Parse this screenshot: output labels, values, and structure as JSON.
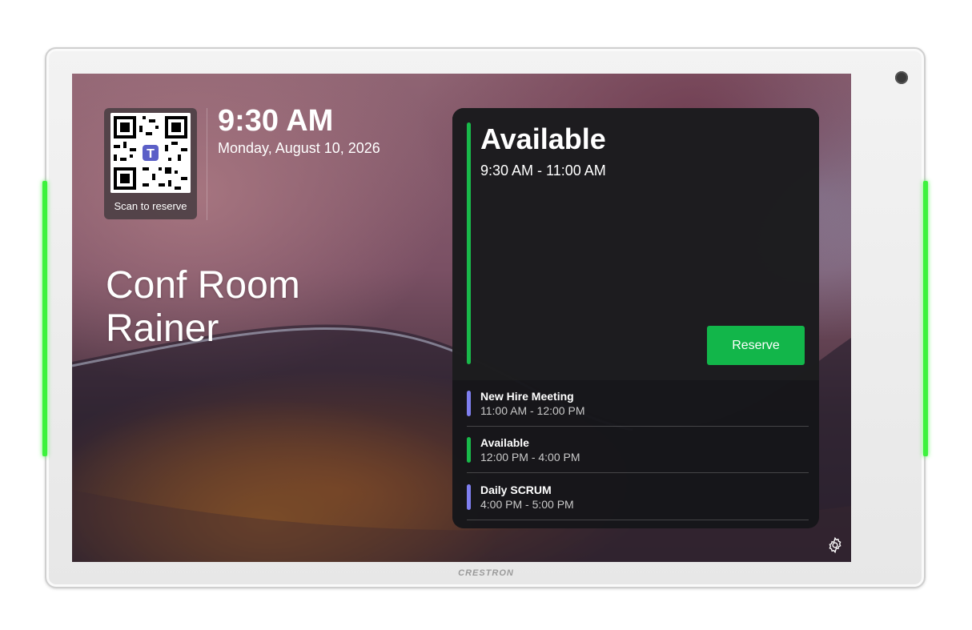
{
  "colors": {
    "available_green": "#19b94a",
    "reserve_button": "#12b64a",
    "led_green": "#3df23d",
    "meeting_purple": "#7f7ff0"
  },
  "device": {
    "brand": "CRESTRON"
  },
  "qr": {
    "caption": "Scan to reserve",
    "icon": "teams-qr-icon"
  },
  "clock": {
    "time": "9:30 AM",
    "date": "Monday, August 10, 2026"
  },
  "room": {
    "line1": "Conf Room",
    "line2": "Rainer"
  },
  "status": {
    "title": "Available",
    "time_range": "9:30 AM - 11:00 AM",
    "reserve_label": "Reserve"
  },
  "meetings": [
    {
      "title": "New Hire Meeting",
      "time": "11:00 AM - 12:00 PM",
      "color": "#7f7ff0"
    },
    {
      "title": "Available",
      "time": "12:00 PM - 4:00 PM",
      "color": "#19b94a"
    },
    {
      "title": "Daily SCRUM",
      "time": "4:00 PM - 5:00 PM",
      "color": "#7f7ff0"
    }
  ],
  "settings": {
    "icon": "gear-icon"
  }
}
